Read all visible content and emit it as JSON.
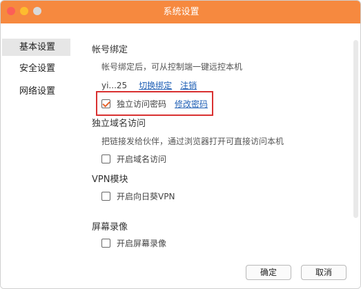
{
  "window": {
    "title": "系统设置"
  },
  "sidebar": {
    "items": [
      {
        "label": "基本设置",
        "active": true
      },
      {
        "label": "安全设置",
        "active": false
      },
      {
        "label": "网络设置",
        "active": false
      }
    ]
  },
  "account": {
    "title": "帐号绑定",
    "desc": "帐号绑定后，可从控制端一键远控本机",
    "account_name": "yi...25",
    "switch_link": "切换绑定",
    "logout_link": "注销",
    "independent_password_label": "独立访问密码",
    "independent_password_checked": true,
    "change_password_link": "修改密码"
  },
  "domain": {
    "title": "独立域名访问",
    "desc": "把链接发给伙伴，通过浏览器打开可直接访问本机",
    "enable_label": "开启域名访问",
    "enabled": false
  },
  "vpn": {
    "title": "VPN模块",
    "enable_label": "开启向日葵VPN",
    "enabled": false
  },
  "recording": {
    "title": "屏幕录像",
    "enable_label": "开启屏幕录像",
    "enabled": false
  },
  "footer": {
    "ok_label": "确定",
    "cancel_label": "取消"
  },
  "colors": {
    "titlebar": "#f6893f",
    "link": "#1f5fb5",
    "highlight": "#d93030",
    "check": "#e5632c"
  }
}
